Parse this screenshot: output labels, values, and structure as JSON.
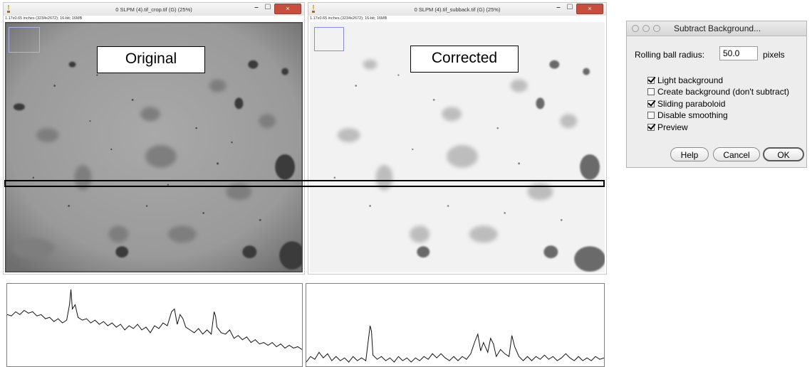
{
  "left_window": {
    "title": "0 SLPM (4).tif_crop.tif (G) (25%)",
    "info": "1.17x0.65 inches (3234x2672); 16-bit; 16MB",
    "overlay_label": "Original"
  },
  "right_window": {
    "title": "0 SLPM (4).tif_subback.tif (G) (25%)",
    "info": "1.17x0.65 inches (3234x2672); 16-bit; 16MB",
    "overlay_label": "Corrected"
  },
  "window_controls": {
    "minimize": "–",
    "maximize": "☐",
    "close": "×"
  },
  "dialog": {
    "title": "Subtract Background...",
    "radius_label": "Rolling ball radius:",
    "radius_value": "50.0",
    "radius_unit": "pixels",
    "options": [
      {
        "label": "Light background",
        "checked": true
      },
      {
        "label": "Create background (don't subtract)",
        "checked": false
      },
      {
        "label": "Sliding paraboloid",
        "checked": true
      },
      {
        "label": "Disable smoothing",
        "checked": false
      },
      {
        "label": "Preview",
        "checked": true
      }
    ],
    "buttons": {
      "help": "Help",
      "cancel": "Cancel",
      "ok": "OK"
    }
  },
  "colors": {
    "close_button": "#c74d3f",
    "selection_box": "#8a8ae6",
    "profile_line": "#000000"
  }
}
